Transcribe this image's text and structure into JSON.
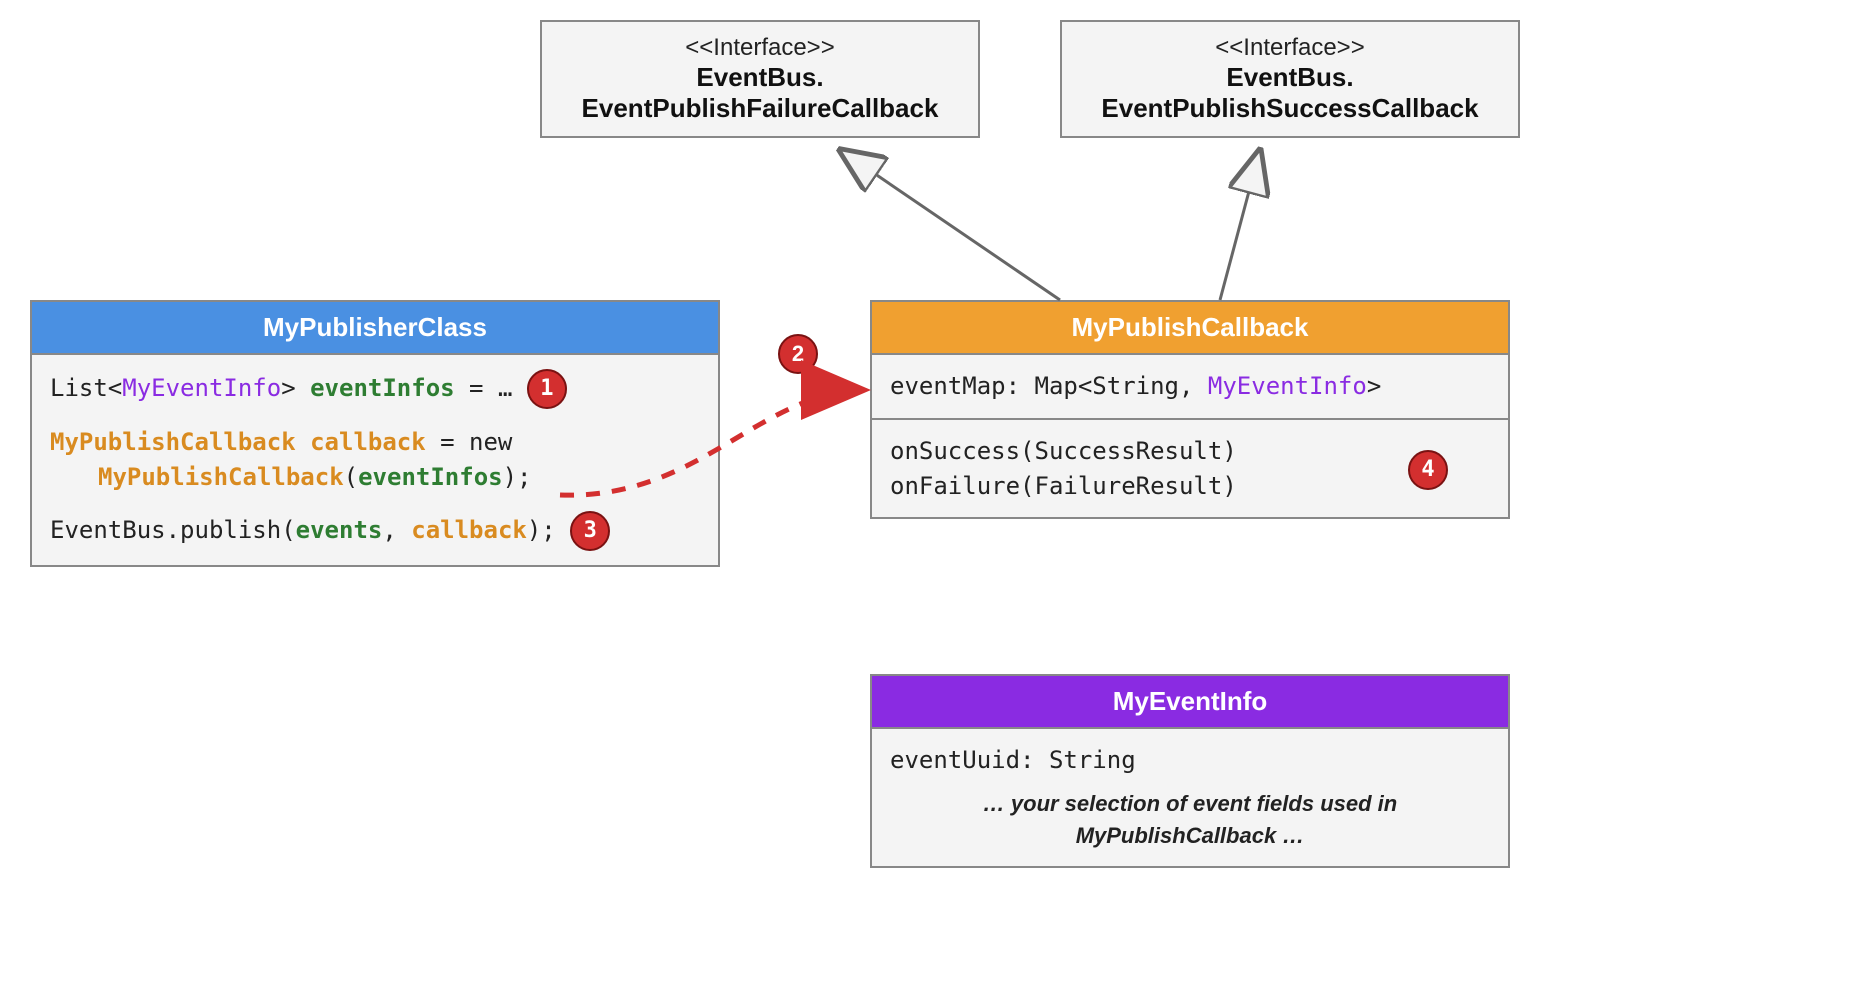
{
  "interfaces": {
    "failure": {
      "stereo": "<<Interface>>",
      "name1": "EventBus.",
      "name2": "EventPublishFailureCallback"
    },
    "success": {
      "stereo": "<<Interface>>",
      "name1": "EventBus.",
      "name2": "EventPublishSuccessCallback"
    }
  },
  "publisher": {
    "title": "MyPublisherClass",
    "line1_a": "List<",
    "line1_type": "MyEventInfo",
    "line1_b": "> ",
    "line1_var": "eventInfos",
    "line1_c": " = … ",
    "line2_type": "MyPublishCallback",
    "line2_var": " callback",
    "line2_b": " = new",
    "line3_ctor": "MyPublishCallback",
    "line3_open": "(",
    "line3_arg": "eventInfos",
    "line3_close": ");",
    "line4_a": "EventBus.publish(",
    "line4_arg1": "events",
    "line4_sep": ", ",
    "line4_arg2": "callback",
    "line4_b": "); "
  },
  "callback": {
    "title": "MyPublishCallback",
    "attr_a": "eventMap: Map<String, ",
    "attr_type": "MyEventInfo",
    "attr_b": ">",
    "m1": "onSuccess(SuccessResult)",
    "m2": "onFailure(FailureResult)"
  },
  "eventinfo": {
    "title": "MyEventInfo",
    "attr": "eventUuid: String",
    "note": "… your selection of event fields used in MyPublishCallback …"
  },
  "badges": {
    "b1": "1",
    "b2": "2",
    "b3": "3",
    "b4": "4"
  }
}
